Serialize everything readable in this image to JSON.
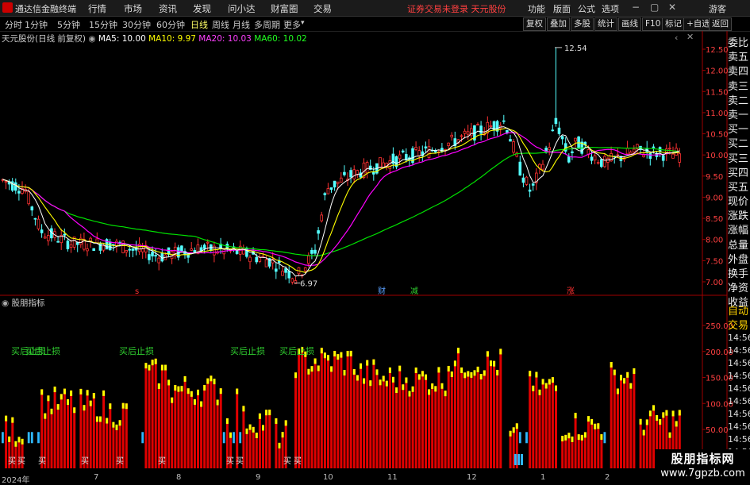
{
  "titlebar": {
    "app_name": "通达信金融终端",
    "menus": [
      "行情",
      "市场",
      "资讯",
      "发现",
      "问小达",
      "财富圈",
      "交易"
    ],
    "notice": "证券交易未登录  天元股份",
    "right": [
      "功能",
      "版面",
      "公式",
      "选项"
    ],
    "user": "游客"
  },
  "periods": [
    "分时",
    "1分钟",
    "5分钟",
    "15分钟",
    "30分钟",
    "60分钟",
    "日线",
    "周线",
    "月线",
    "多周期",
    "更多"
  ],
  "active_period": "日线",
  "right_tools": [
    "复权",
    "叠加",
    "多股",
    "统计",
    "画线",
    "F10",
    "标记",
    "+自选",
    "返回"
  ],
  "legend": {
    "stock": "天元股份(日线 前复权)",
    "ma5": "MA5: 10.00",
    "ma10": "MA10: 9.97",
    "ma20": "MA20: 10.03",
    "ma60": "MA60: 10.02"
  },
  "colors": {
    "up": "#ff3232",
    "down": "#54ffff",
    "ma5": "#ffffff",
    "ma10": "#ffff00",
    "ma20": "#ff00ff",
    "ma60": "#00e000",
    "bar_up": "#e00000",
    "bar_tip": "#ffff00"
  },
  "right_side": [
    "委比",
    "卖五",
    "卖四",
    "卖三",
    "卖二",
    "卖一",
    "买一",
    "买二",
    "买三",
    "买四",
    "买五",
    "现价",
    "涨跌",
    "涨幅",
    "总量",
    "外盘",
    "换手",
    "净资",
    "收益"
  ],
  "right_side_lower": [
    "自动",
    "交易"
  ],
  "ticker_times": [
    "14:56",
    "14:56",
    "14:56",
    "14:56",
    "14:56",
    "14:56",
    "14:56",
    "14:56",
    "14:56",
    "14:56"
  ],
  "price_axis": [
    "12.50",
    "12.00",
    "11.50",
    "11.00",
    "10.50",
    "10.00",
    "9.50",
    "9.00",
    "8.50",
    "8.00",
    "7.50",
    "7.00"
  ],
  "indicator_axis": [
    "250.00",
    "200.00",
    "150.00",
    "100.00",
    "50.00"
  ],
  "annotations": {
    "high": "12.54",
    "low": "6.97",
    "event_markers": [
      "s",
      "财",
      "减",
      "涨"
    ],
    "buy_labels": [
      "买后止损",
      "买后止损",
      "买后止损",
      "买后止损",
      "买后止损"
    ],
    "bottom_tags": [
      "买",
      "买",
      "买",
      "买",
      "买",
      "买",
      "买",
      "买",
      "买",
      "买"
    ]
  },
  "indicator_name": "股朋指标",
  "dates": [
    "2024年",
    "7",
    "8",
    "9",
    "10",
    "11",
    "12",
    "1",
    "2"
  ],
  "watermark": {
    "line1": "股朋指标网",
    "line2": "www.7gpzb.com"
  }
}
